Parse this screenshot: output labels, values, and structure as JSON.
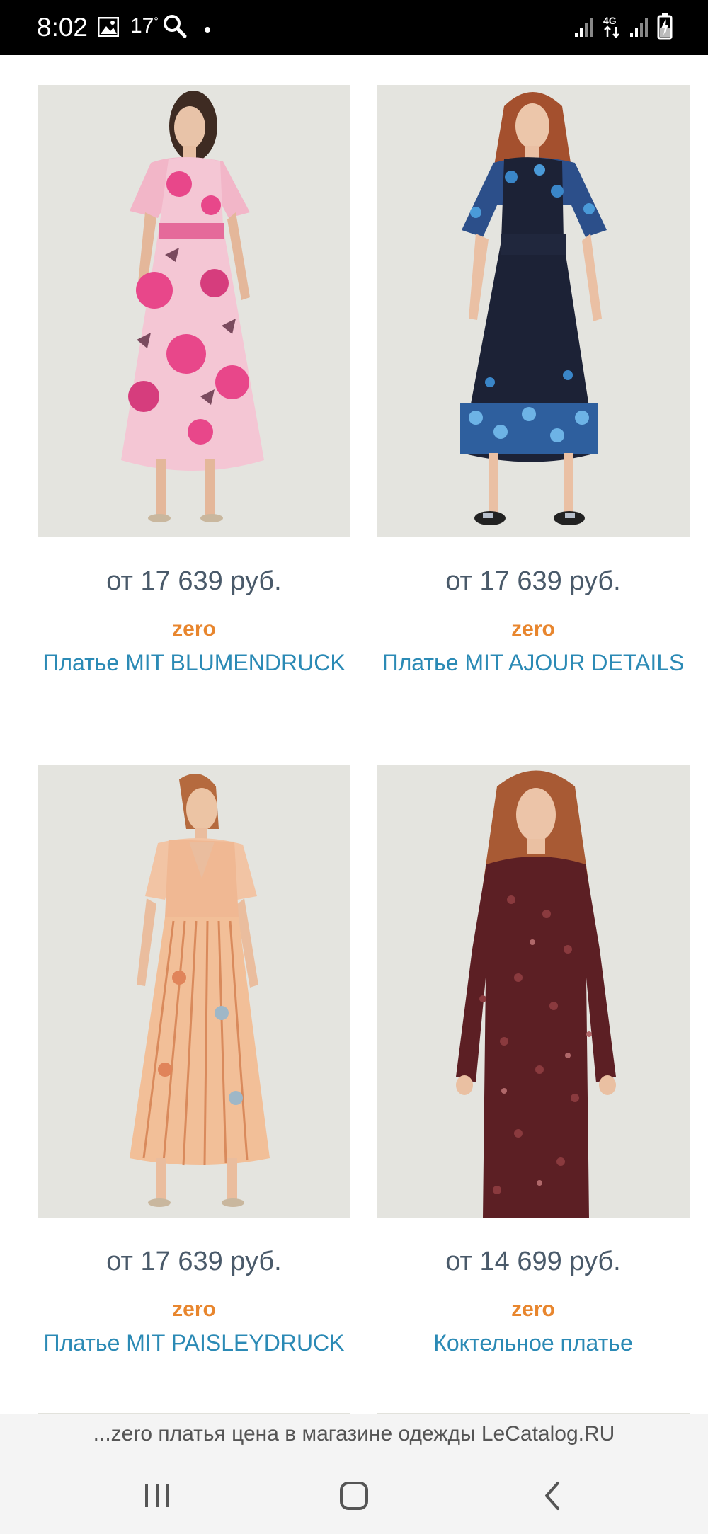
{
  "status_bar": {
    "time": "8:02",
    "temperature": "17",
    "temperature_unit": "°",
    "network": "4G",
    "icons": [
      "gallery-icon",
      "search-icon",
      "dot-icon",
      "signal-icon",
      "network-4g-icon",
      "signal-icon",
      "battery-charging-icon"
    ]
  },
  "products": [
    {
      "price": "от 17 639 руб.",
      "brand": "zero",
      "name": "Платье MIT BLUMENDRUCK",
      "image": "pink-floral-maxi-dress-photo"
    },
    {
      "price": "от 17 639 руб.",
      "brand": "zero",
      "name": "Платье MIT AJOUR DETAILS",
      "image": "navy-blue-floral-midi-dress-photo"
    },
    {
      "price": "от 17 639 руб.",
      "brand": "zero",
      "name": "Платье MIT PAISLEYDRUCK",
      "image": "peach-paisley-pleated-dress-photo"
    },
    {
      "price": "от 14 699 руб.",
      "brand": "zero",
      "name": "Коктельное платье",
      "image": "burgundy-sequin-mini-dress-photo"
    }
  ],
  "url_banner": "...zero платья цена в магазине одежды LeCatalog.RU",
  "nav_bar": {
    "buttons": [
      "recent-apps-button",
      "home-button",
      "back-button"
    ]
  },
  "colors": {
    "price": "#4a5a6a",
    "brand": "#e8862e",
    "name": "#2b8ab5",
    "photo_background": "#e4e4df"
  }
}
